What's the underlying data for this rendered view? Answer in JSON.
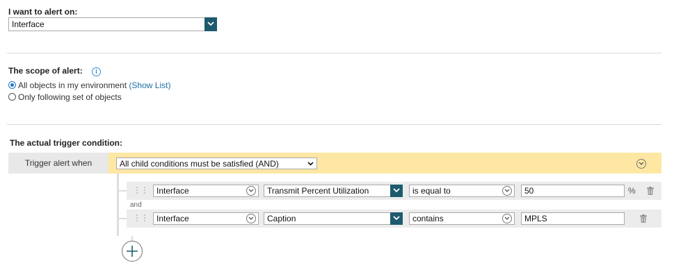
{
  "alert_on": {
    "heading": "I want to alert on:",
    "selected": "Interface"
  },
  "scope": {
    "heading": "The scope of alert:",
    "info_icon": "info-icon",
    "option_all": "All objects in my environment",
    "show_list": "(Show List)",
    "option_following": "Only following set of objects",
    "selected_option": "all"
  },
  "trigger": {
    "heading": "The actual trigger condition:",
    "when_label": "Trigger alert when",
    "group_condition": "All child conditions must be satisfied (AND)",
    "joiner": "and",
    "rows": [
      {
        "object": "Interface",
        "field": "Transmit Percent Utilization",
        "operator": "is equal to",
        "value": "50",
        "unit": "%"
      },
      {
        "object": "Interface",
        "field": "Caption",
        "operator": "contains",
        "value": "MPLS",
        "unit": ""
      }
    ],
    "add_icon": "plus-circle-icon",
    "delete_icon": "trash-icon",
    "drag_icon": "drag-grip-icon"
  },
  "colors": {
    "accent_dark": "#1d5a6e",
    "condition_bar": "#fde7a3",
    "link": "#1b6fa5"
  }
}
